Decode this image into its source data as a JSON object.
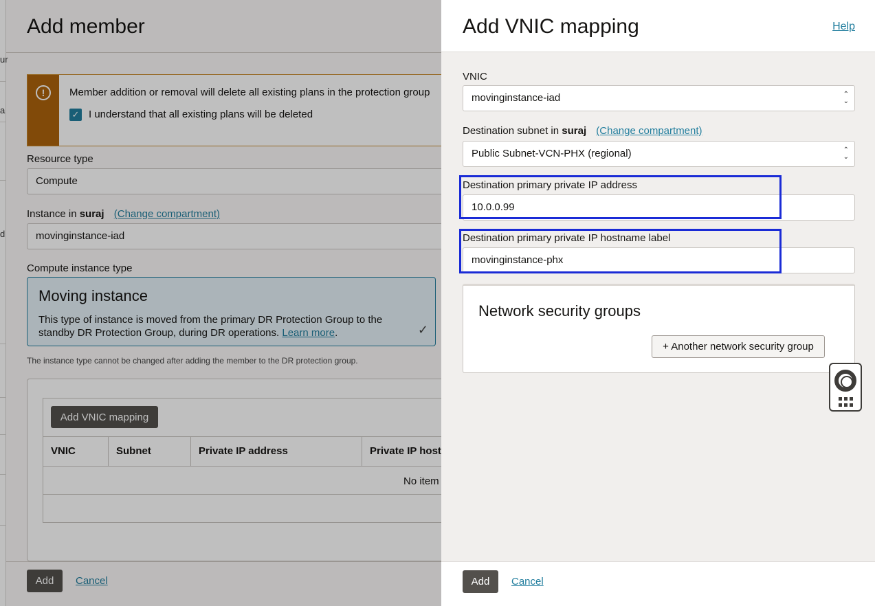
{
  "background": {
    "title": "Add member",
    "strip_chars": [
      "ur",
      "a",
      "d"
    ],
    "warning": {
      "message": "Member addition or removal will delete all existing plans in the protection group",
      "checkbox_label": "I understand that all existing plans will be deleted",
      "checked": true
    },
    "resource_type": {
      "label": "Resource type",
      "value": "Compute"
    },
    "instance": {
      "label_prefix": "Instance in",
      "compartment": "suraj",
      "change_link": "(Change compartment)",
      "value": "movinginstance-iad"
    },
    "compute_instance_type": {
      "label": "Compute instance type",
      "card_title": "Moving instance",
      "card_desc": "This type of instance is moved from the primary DR Protection Group to the standby DR Protection Group, during DR operations.",
      "learn_more": "Learn more",
      "period": "."
    },
    "note": "The instance type cannot be changed after adding the member to the DR protection group.",
    "vnic_table": {
      "add_button": "Add VNIC mapping",
      "columns": [
        "VNIC",
        "Subnet",
        "Private IP address",
        "Private IP host"
      ],
      "empty_text": "No item"
    },
    "footer": {
      "add": "Add",
      "cancel": "Cancel"
    }
  },
  "panel": {
    "title": "Add VNIC mapping",
    "help": "Help",
    "vnic": {
      "label": "VNIC",
      "value": "movinginstance-iad"
    },
    "dest_subnet": {
      "label_prefix": "Destination subnet in",
      "compartment": "suraj",
      "change_link": "(Change compartment)",
      "value": "Public Subnet-VCN-PHX (regional)"
    },
    "dest_ip": {
      "label": "Destination primary private IP address",
      "value": "10.0.0.99"
    },
    "dest_hostname": {
      "label": "Destination primary private IP hostname label",
      "value": "movinginstance-phx"
    },
    "nsg": {
      "title": "Network security groups",
      "button": "+ Another network security group"
    },
    "footer": {
      "add": "Add",
      "cancel": "Cancel"
    }
  },
  "colors": {
    "accent": "#227e9e",
    "warning": "#ac630c",
    "highlight": "#1a2bd6",
    "dark_button": "#53504c"
  }
}
